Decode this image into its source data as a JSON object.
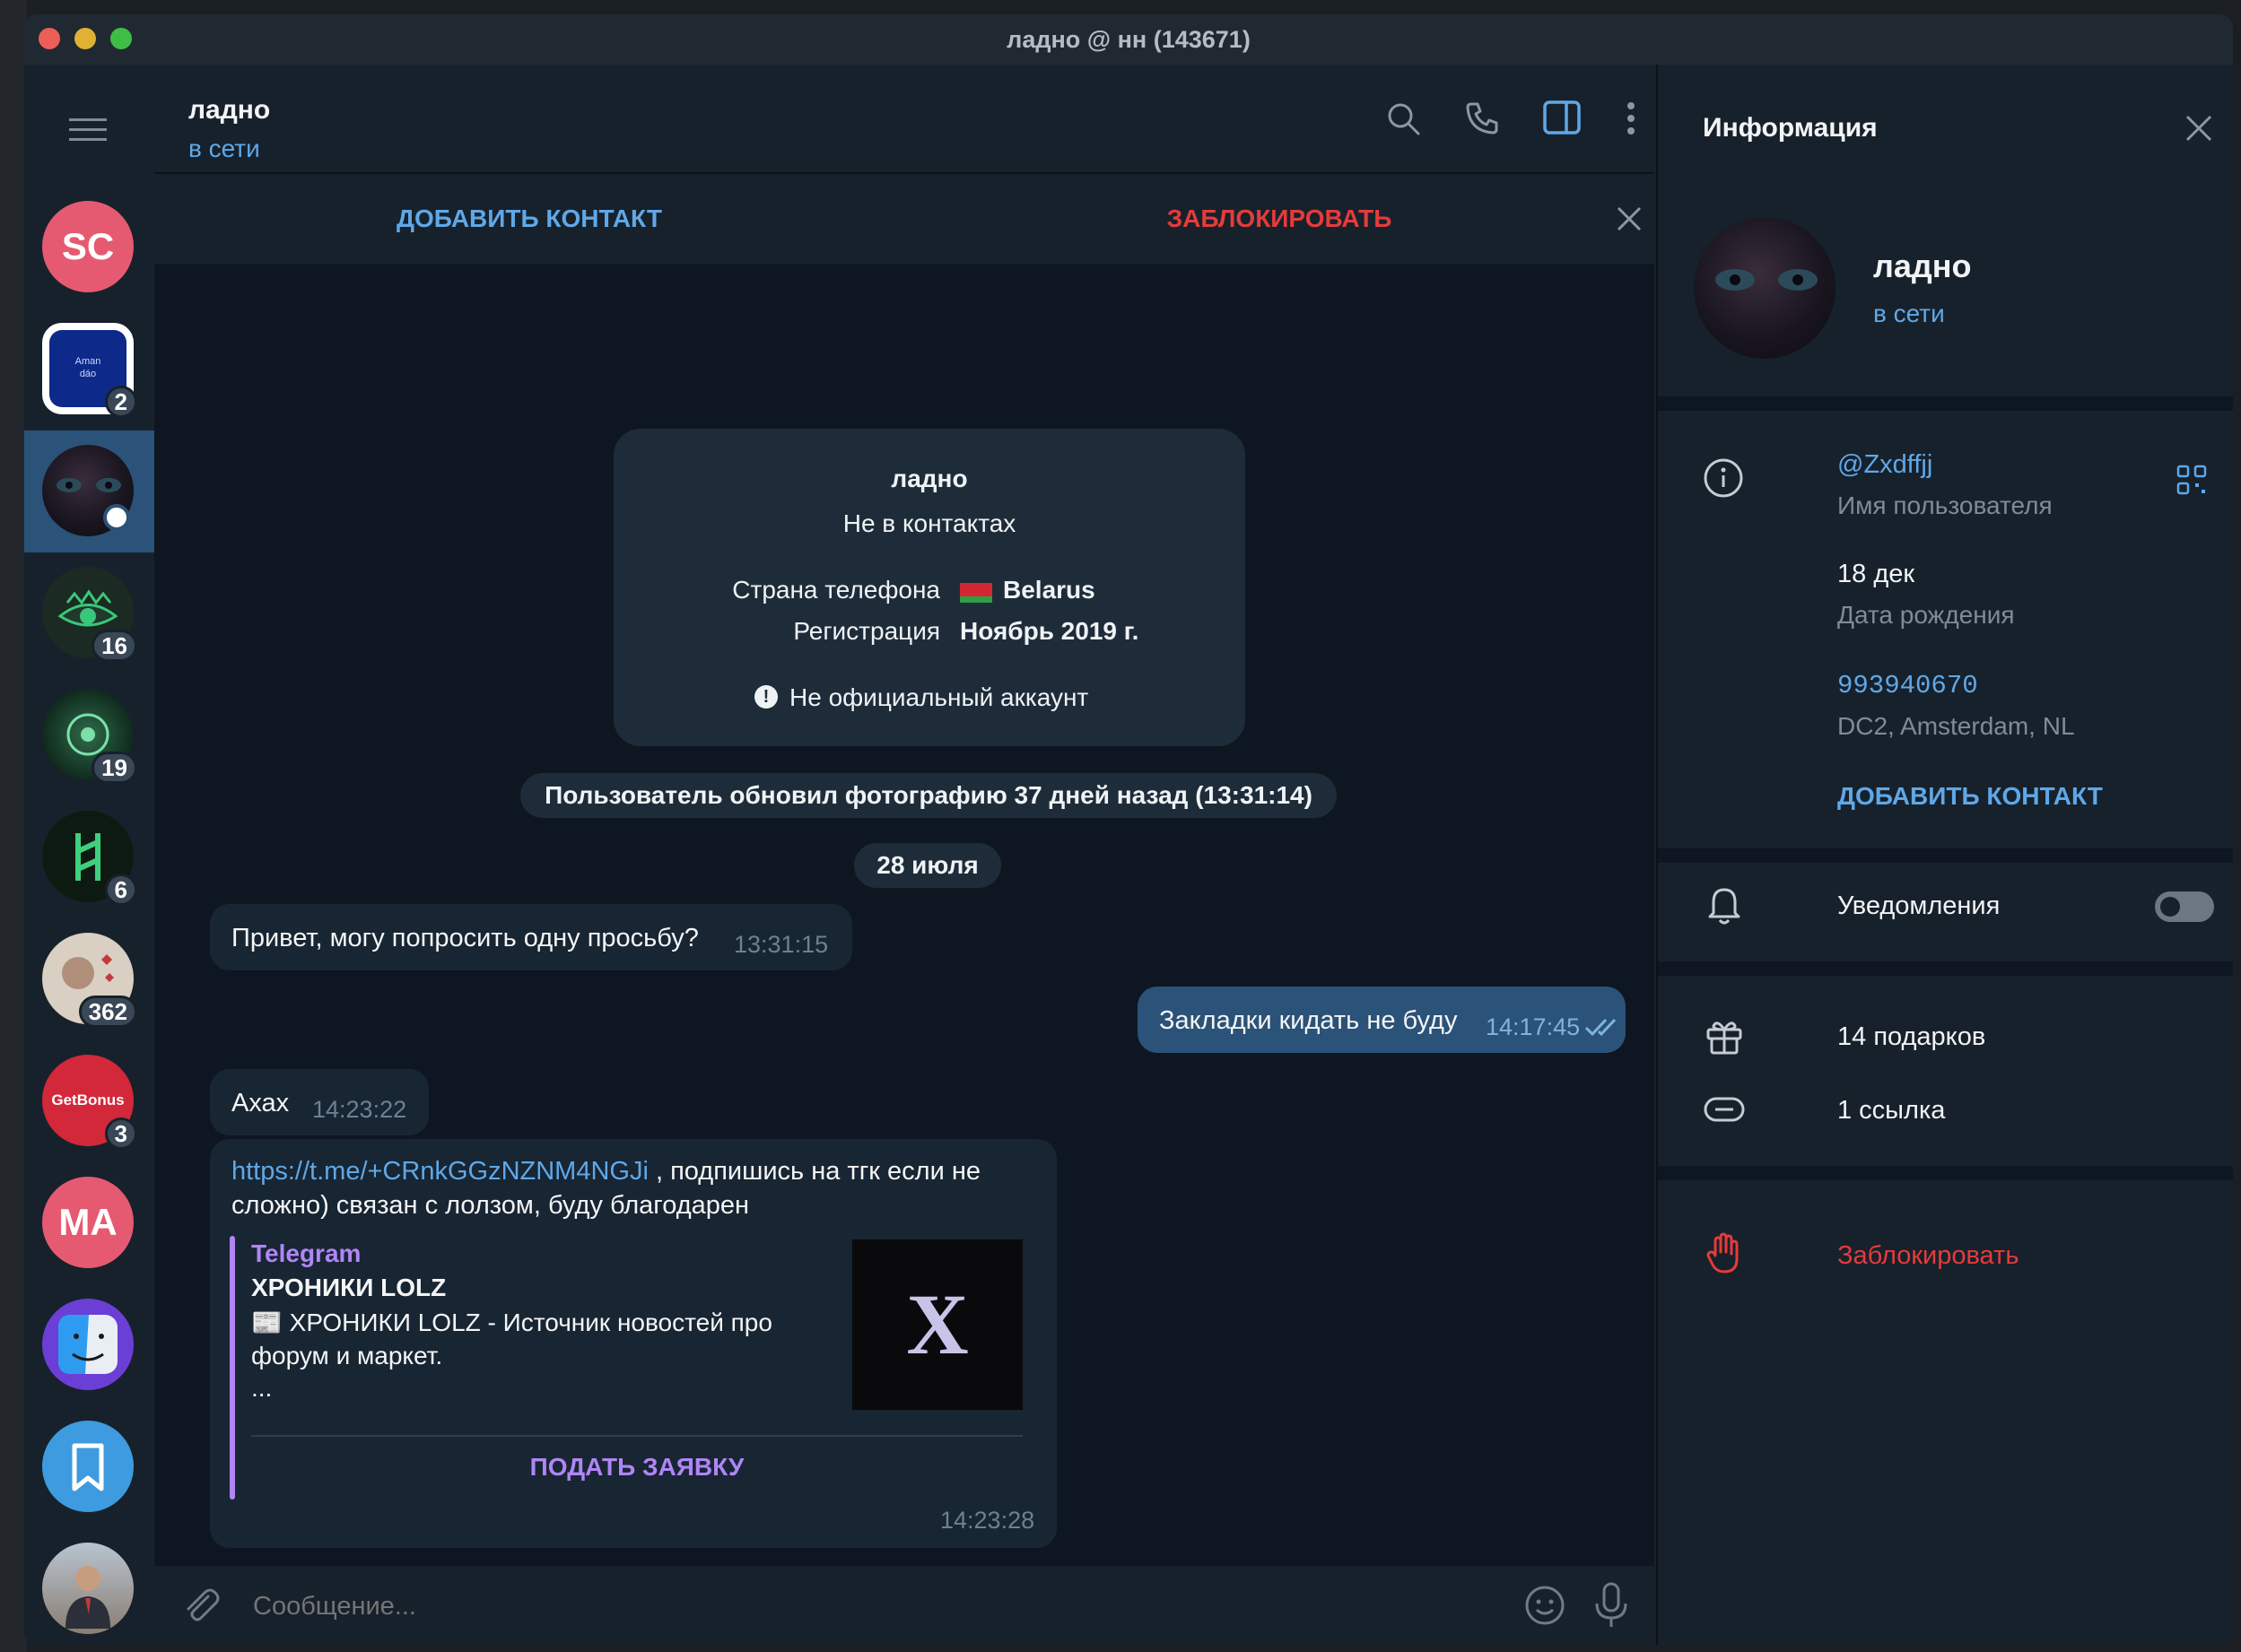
{
  "window": {
    "title": "ладно @ нн (143671)",
    "traffic_lights": [
      "#ec5f57",
      "#e0b132",
      "#3ebe46"
    ]
  },
  "sidebar": {
    "menu_icon": "hamburger-icon",
    "chats": [
      {
        "name": "SC",
        "initials": "SC",
        "color": "#e65a71"
      },
      {
        "name": "Aman dao",
        "badge": "2",
        "icon": "app-avatar-blue"
      },
      {
        "name": "ладно",
        "selected": true,
        "online": true
      },
      {
        "name": "eye-avatar",
        "badge": "16"
      },
      {
        "name": "matrix-avatar",
        "badge": "19"
      },
      {
        "name": "rune-avatar",
        "badge": "6"
      },
      {
        "name": "art-avatar",
        "badge": "362"
      },
      {
        "name": "GetBonus",
        "label": "GetBonus",
        "badge": "3",
        "color": "#d2283a"
      },
      {
        "name": "MA",
        "initials": "MA",
        "color": "#e65a71"
      },
      {
        "name": "finder-avatar",
        "icon": "finder-icon"
      },
      {
        "name": "saved-messages",
        "icon": "bookmark-icon"
      },
      {
        "name": "person-avatar"
      }
    ]
  },
  "chat": {
    "header": {
      "name": "ладно",
      "status": "в сети"
    },
    "action_bar": {
      "add_contact": "ДОБАВИТЬ КОНТАКТ",
      "block": "ЗАБЛОКИРОВАТЬ"
    },
    "info_card": {
      "name": "ладно",
      "subtitle": "Не в контактах",
      "phone_country_label": "Страна телефона",
      "phone_country_value": "Belarus",
      "registration_label": "Регистрация",
      "registration_value": "Ноябрь 2019 г.",
      "unofficial": "Не официальный аккаунт"
    },
    "service_message": "Пользователь обновил фотографию 37 дней назад (13:31:14)",
    "date_pill": "28 июля",
    "messages": [
      {
        "dir": "in",
        "text": "Привет, могу попросить одну просьбу?",
        "time": "13:31:15"
      },
      {
        "dir": "out",
        "text": "Закладки кидать не буду",
        "time": "14:17:45"
      },
      {
        "dir": "in",
        "text": "Ахах",
        "time": "14:23:22"
      },
      {
        "dir": "in",
        "link": "https://t.me/+CRnkGGzNZNM4NGJi",
        "text_line1": " , подпишись на тгк если не",
        "text_line2": "сложно) связан с лолзом, буду благодарен",
        "time": "14:23:28",
        "preview": {
          "site": "Telegram",
          "title": "ХРОНИКИ LOLZ",
          "desc_line1": "📰 ХРОНИКИ LOLZ - Источник новостей про",
          "desc_line2": "форум и маркет.",
          "desc_line3": "...",
          "thumb_letter": "X",
          "button": "ПОДАТЬ ЗАЯВКУ"
        }
      }
    ],
    "compose": {
      "placeholder": "Сообщение..."
    }
  },
  "info_panel": {
    "title": "Информация",
    "name": "ладно",
    "status": "в сети",
    "username": "@Zxdffjj",
    "username_label": "Имя пользователя",
    "birthday": "18 дек",
    "birthday_label": "Дата рождения",
    "phone": "993940670",
    "dc": "DC2, Amsterdam, NL",
    "add_contact": "ДОБАВИТЬ КОНТАКТ",
    "notifications": "Уведомления",
    "notifications_on": false,
    "gifts": "14 подарков",
    "links": "1 ссылка",
    "block": "Заблокировать"
  },
  "colors": {
    "accent": "#5fa8e8",
    "danger": "#e53b3b",
    "bubble_out": "#2b5278",
    "bubble_in": "#182533",
    "purple": "#b085f5"
  }
}
